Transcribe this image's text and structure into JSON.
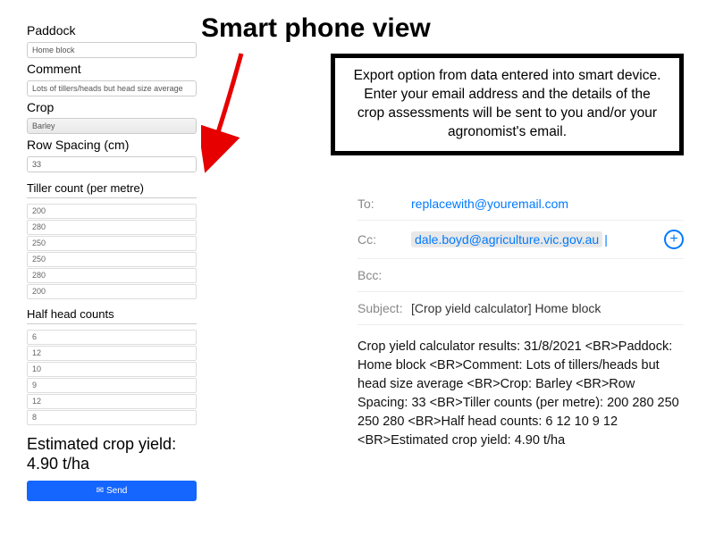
{
  "title": "Smart phone view",
  "info_box": "Export option from data entered into smart device. Enter your email address and the details of the crop assessments will be sent to you and/or your agronomist's email.",
  "form": {
    "paddock_label": "Paddock",
    "paddock_value": "Home block",
    "comment_label": "Comment",
    "comment_value": "Lots of tillers/heads but head size average",
    "crop_label": "Crop",
    "crop_value": "Barley",
    "row_spacing_label": "Row Spacing (cm)",
    "row_spacing_value": "33",
    "tiller_label": "Tiller count (per metre)",
    "tiller_values": [
      "200",
      "280",
      "250",
      "250",
      "280",
      "200"
    ],
    "half_head_label": "Half head counts",
    "half_head_values": [
      "6",
      "12",
      "10",
      "9",
      "12",
      "8"
    ],
    "estimated_label": "Estimated crop yield:",
    "estimated_value": "4.90 t/ha",
    "send_label": "Send"
  },
  "email": {
    "to_label": "To:",
    "to_value": "replacewith@youremail.com",
    "cc_label": "Cc:",
    "cc_value": "dale.boyd@agriculture.vic.gov.au",
    "bcc_label": "Bcc:",
    "subject_label": "Subject:",
    "subject_value": "[Crop yield calculator] Home block",
    "body": "Crop yield calculator results: 31/8/2021 <BR>Paddock: Home block <BR>Comment: Lots of tillers/heads but head size average <BR>Crop: Barley <BR>Row Spacing: 33 <BR>Tiller counts (per metre): 200 280 250 250 280 <BR>Half head counts: 6 12 10 9 12 <BR>Estimated crop yield: 4.90 t/ha"
  }
}
